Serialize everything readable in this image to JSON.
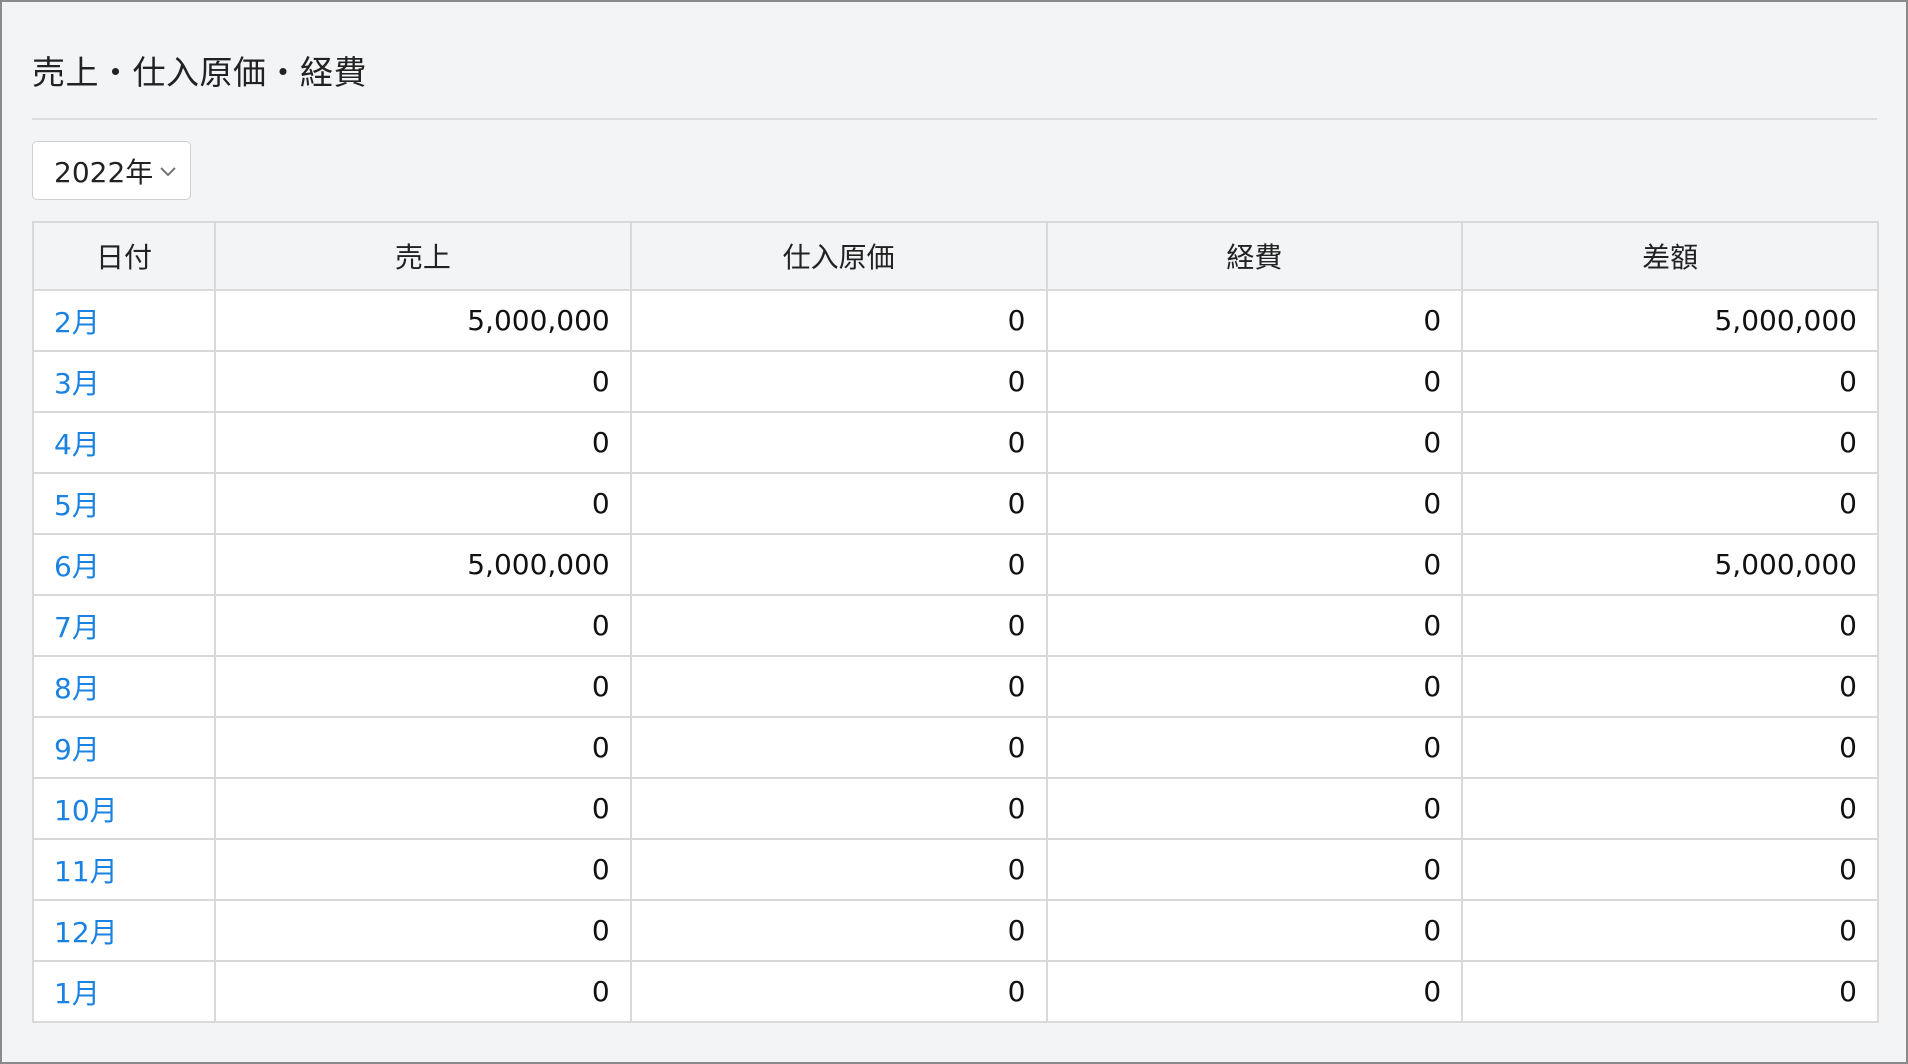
{
  "panel": {
    "title": "売上・仕入原価・経費"
  },
  "year_select": {
    "value": "2022年",
    "icon": "chevron-down-icon"
  },
  "table": {
    "headers": [
      "日付",
      "売上",
      "仕入原価",
      "経費",
      "差額"
    ],
    "rows": [
      {
        "month": "2月",
        "sales": "5,000,000",
        "cost": "0",
        "expense": "0",
        "diff": "5,000,000"
      },
      {
        "month": "3月",
        "sales": "0",
        "cost": "0",
        "expense": "0",
        "diff": "0"
      },
      {
        "month": "4月",
        "sales": "0",
        "cost": "0",
        "expense": "0",
        "diff": "0"
      },
      {
        "month": "5月",
        "sales": "0",
        "cost": "0",
        "expense": "0",
        "diff": "0"
      },
      {
        "month": "6月",
        "sales": "5,000,000",
        "cost": "0",
        "expense": "0",
        "diff": "5,000,000"
      },
      {
        "month": "7月",
        "sales": "0",
        "cost": "0",
        "expense": "0",
        "diff": "0"
      },
      {
        "month": "8月",
        "sales": "0",
        "cost": "0",
        "expense": "0",
        "diff": "0"
      },
      {
        "month": "9月",
        "sales": "0",
        "cost": "0",
        "expense": "0",
        "diff": "0"
      },
      {
        "month": "10月",
        "sales": "0",
        "cost": "0",
        "expense": "0",
        "diff": "0"
      },
      {
        "month": "11月",
        "sales": "0",
        "cost": "0",
        "expense": "0",
        "diff": "0"
      },
      {
        "month": "12月",
        "sales": "0",
        "cost": "0",
        "expense": "0",
        "diff": "0"
      },
      {
        "month": "1月",
        "sales": "0",
        "cost": "0",
        "expense": "0",
        "diff": "0"
      }
    ]
  },
  "colors": {
    "link": "#1a82e2",
    "background": "#f3f4f6",
    "border": "#d9d9d9"
  }
}
